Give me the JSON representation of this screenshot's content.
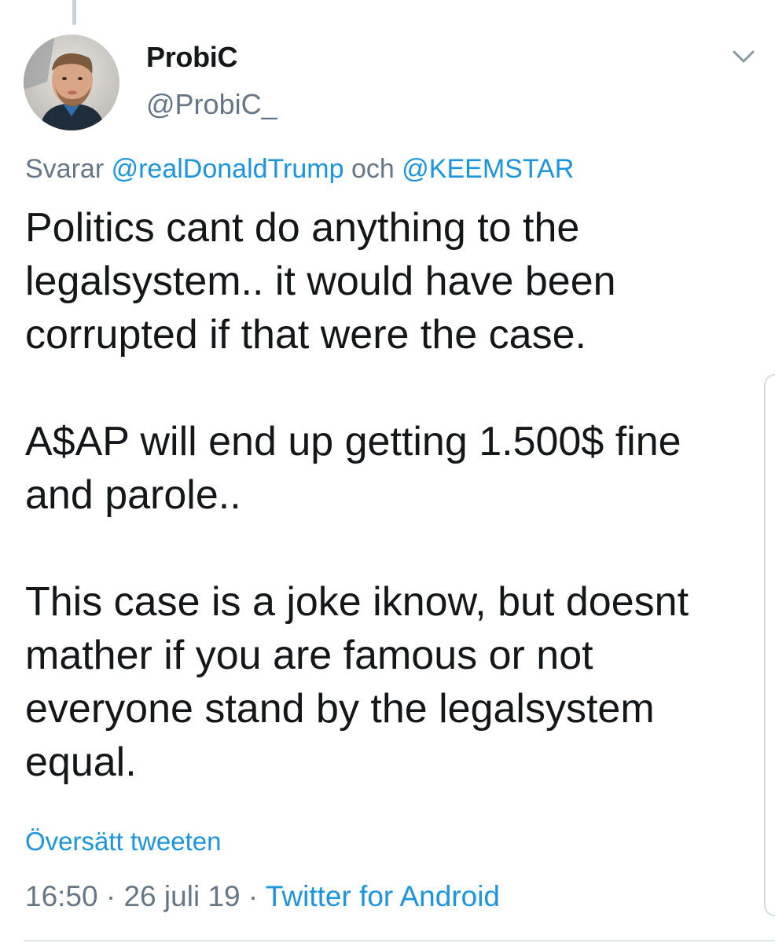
{
  "author": {
    "display_name": "ProbiC",
    "handle": "@ProbiC_",
    "avatar": "avatar-photo"
  },
  "icons": {
    "menu": "chevron-down-icon"
  },
  "reply": {
    "prefix": "Svarar",
    "mention_1": "@realDonaldTrump",
    "conjunction": "och",
    "mention_2": "@KEEMSTAR"
  },
  "tweet": {
    "paragraphs": [
      "Politics cant do anything to the legalsystem.. it would have been corrupted if that were the case.",
      "A$AP will end up getting 1.500$ fine and parole..",
      "This case is a joke iknow,  but doesnt mather if you are famous or not everyone stand by the legalsystem equal."
    ]
  },
  "translate_label": "Översätt tweeten",
  "meta": {
    "time": "16:50",
    "separator": "·",
    "date": "26 juli 19",
    "source": "Twitter for Android"
  },
  "colors": {
    "link": "#1b95e0",
    "secondary_text": "#657786",
    "primary_text": "#14171a",
    "divider": "#e1e8ed"
  }
}
